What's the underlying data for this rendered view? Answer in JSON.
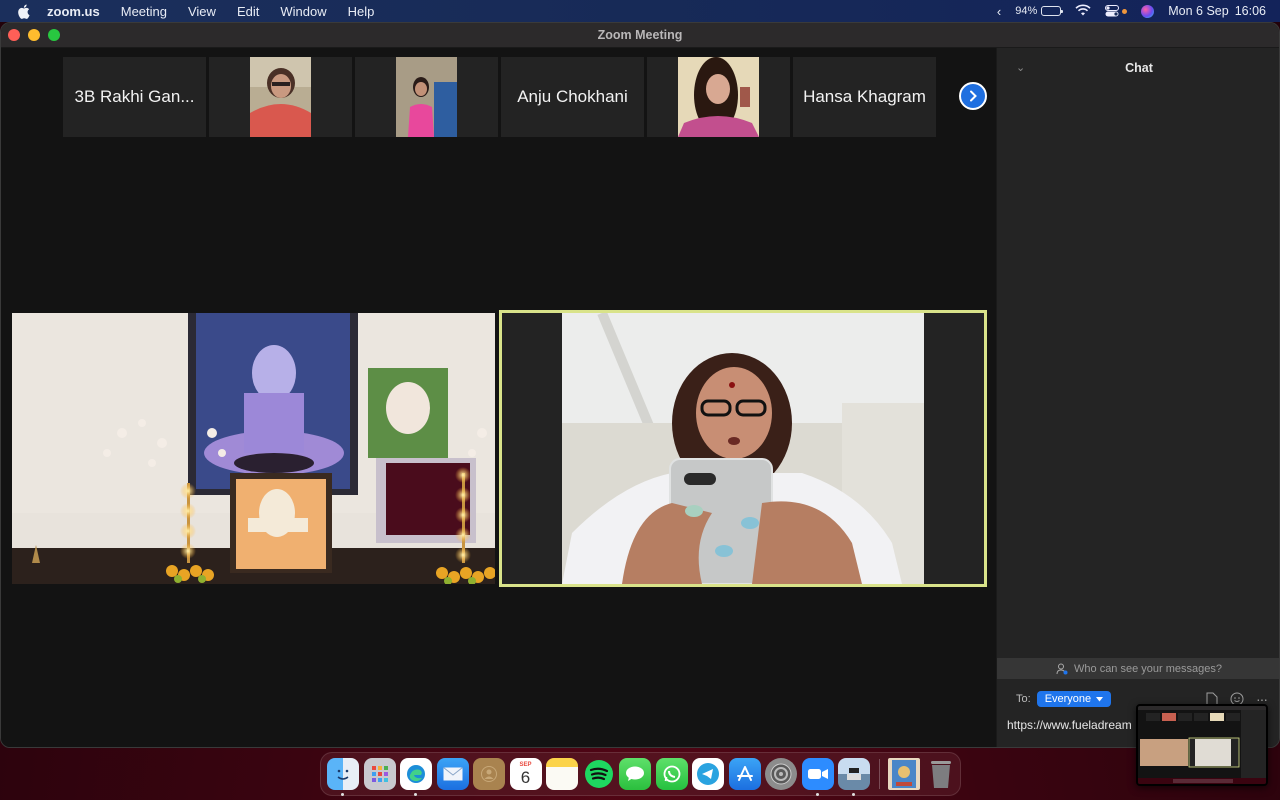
{
  "menubar": {
    "apple_icon": "apple-logo-icon",
    "app_name": "zoom.us",
    "menus": [
      "Meeting",
      "View",
      "Edit",
      "Window",
      "Help"
    ],
    "status": {
      "battery_percent": "94%",
      "battery_level": 0.94,
      "date": "Mon 6 Sep",
      "time": "16:06"
    }
  },
  "window": {
    "title": "Zoom Meeting"
  },
  "gallery_strip": {
    "participants": [
      {
        "type": "name",
        "label": "3B Rakhi Gan..."
      },
      {
        "type": "video",
        "label": "participant video - woman in red top"
      },
      {
        "type": "video",
        "label": "participant video - girl in pink dress"
      },
      {
        "type": "name",
        "label": "Anju Chokhani"
      },
      {
        "type": "video",
        "label": "participant video - smiling woman"
      },
      {
        "type": "name",
        "label": "Hansa Khagram"
      }
    ],
    "next_icon": "chevron-right-icon"
  },
  "main_videos": [
    {
      "label": "shared video - altar with deity pictures and lamps",
      "active_speaker": false
    },
    {
      "label": "active speaker video - woman with phone",
      "active_speaker": true,
      "highlight_color": "#d9e38a"
    }
  ],
  "chat": {
    "title": "Chat",
    "visibility_prompt": "Who can see your messages?",
    "to_label": "To:",
    "recipient": "Everyone",
    "input_value": "https://www.fueladream",
    "tools": [
      "file-icon",
      "emoji-icon",
      "more-icon"
    ]
  },
  "dock": {
    "apps": [
      {
        "name": "Finder",
        "running": true
      },
      {
        "name": "Launchpad",
        "running": false
      },
      {
        "name": "Microsoft Edge",
        "running": true
      },
      {
        "name": "Mail",
        "running": false
      },
      {
        "name": "Contacts",
        "running": false
      },
      {
        "name": "Calendar",
        "running": false,
        "month": "SEP",
        "day": "6"
      },
      {
        "name": "Notes",
        "running": false
      },
      {
        "name": "Spotify",
        "running": false
      },
      {
        "name": "Messages",
        "running": false
      },
      {
        "name": "WhatsApp",
        "running": false
      },
      {
        "name": "Telegram",
        "running": false
      },
      {
        "name": "App Store",
        "running": false
      },
      {
        "name": "System Preferences",
        "running": false
      },
      {
        "name": "Zoom",
        "running": true
      },
      {
        "name": "Preview",
        "running": true
      },
      {
        "name": "Image Document",
        "running": false
      },
      {
        "name": "Trash",
        "running": false
      }
    ]
  },
  "colors": {
    "accent_blue": "#1f75ec",
    "active_speaker_border": "#d9e38a"
  }
}
